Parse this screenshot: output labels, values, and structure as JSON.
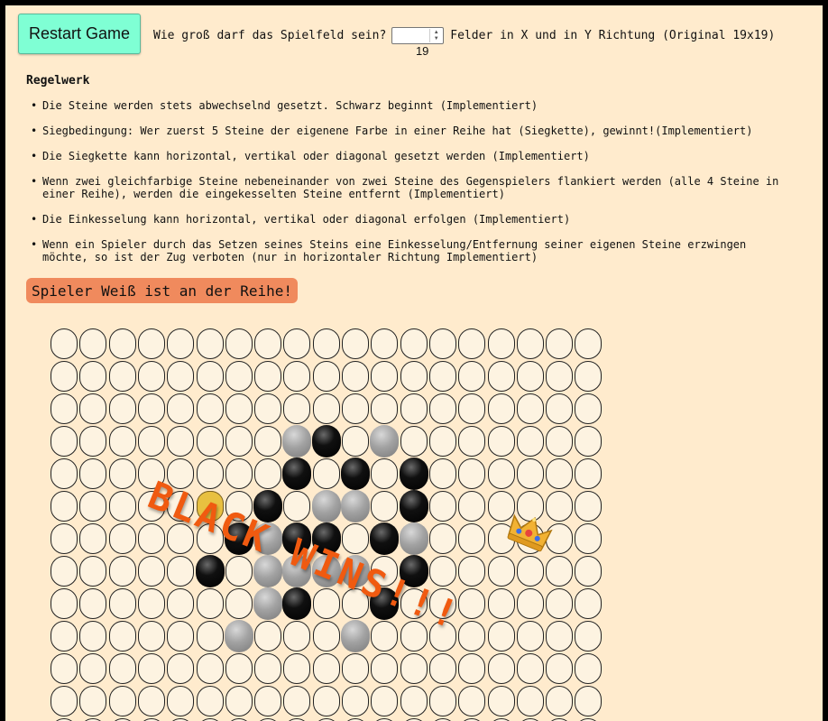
{
  "controls": {
    "restart_label": "Restart Game",
    "size_question": "Wie groß darf das Spielfeld sein?",
    "size_value": "19",
    "size_suffix": "Felder in X und in Y Richtung (Original 19x19)"
  },
  "rules": {
    "title": "Regelwerk",
    "items": [
      "Die Steine werden stets abwechselnd gesetzt. Schwarz beginnt (Implementiert)",
      "Siegbedingung: Wer zuerst 5 Steine der eigenene Farbe in einer Reihe hat (Siegkette), gewinnt!(Implementiert)",
      "Die Siegkette kann horizontal, vertikal oder diagonal gesetzt werden (Implementiert)",
      "Wenn zwei gleichfarbige Steine nebeneinander von zwei Steine des Gegenspielers flankiert werden (alle 4 Steine in einer Reihe), werden die eingekesselten Steine entfernt (Implementiert)",
      "Die Einkesselung kann horizontal, vertikal oder diagonal erfolgen (Implementiert)",
      "Wenn ein Spieler durch das Setzen seines Steins eine Einkesselung/Entfernung seiner eigenen Steine erzwingen möchte, so ist der Zug verboten (nur in horizontaler Richtung Implementiert)"
    ]
  },
  "status": {
    "turn_text": "Spieler Weiß ist an der Reihe!",
    "turn_color": "#f08a5d"
  },
  "board": {
    "columns": 19,
    "visible_rows": 13,
    "stones": [
      {
        "r": 3,
        "c": 8,
        "color": "gray"
      },
      {
        "r": 3,
        "c": 9,
        "color": "black"
      },
      {
        "r": 3,
        "c": 11,
        "color": "gray"
      },
      {
        "r": 4,
        "c": 8,
        "color": "black"
      },
      {
        "r": 4,
        "c": 10,
        "color": "black"
      },
      {
        "r": 4,
        "c": 12,
        "color": "black"
      },
      {
        "r": 5,
        "c": 5,
        "color": "gold"
      },
      {
        "r": 5,
        "c": 7,
        "color": "black"
      },
      {
        "r": 5,
        "c": 9,
        "color": "gray"
      },
      {
        "r": 5,
        "c": 10,
        "color": "gray"
      },
      {
        "r": 5,
        "c": 12,
        "color": "black"
      },
      {
        "r": 6,
        "c": 6,
        "color": "black"
      },
      {
        "r": 6,
        "c": 7,
        "color": "gray"
      },
      {
        "r": 6,
        "c": 8,
        "color": "black"
      },
      {
        "r": 6,
        "c": 9,
        "color": "black"
      },
      {
        "r": 6,
        "c": 11,
        "color": "black"
      },
      {
        "r": 6,
        "c": 12,
        "color": "gray"
      },
      {
        "r": 7,
        "c": 5,
        "color": "black"
      },
      {
        "r": 7,
        "c": 7,
        "color": "gray"
      },
      {
        "r": 7,
        "c": 8,
        "color": "gray"
      },
      {
        "r": 7,
        "c": 9,
        "color": "gray"
      },
      {
        "r": 7,
        "c": 10,
        "color": "gray"
      },
      {
        "r": 7,
        "c": 12,
        "color": "black"
      },
      {
        "r": 8,
        "c": 7,
        "color": "gray"
      },
      {
        "r": 8,
        "c": 8,
        "color": "black"
      },
      {
        "r": 8,
        "c": 11,
        "color": "black"
      },
      {
        "r": 9,
        "c": 6,
        "color": "gray"
      },
      {
        "r": 9,
        "c": 10,
        "color": "gray"
      }
    ]
  },
  "overlay": {
    "win_text": "BLACK WINS!!!",
    "win_color": "#f05a10",
    "crown_icon": "crown-icon"
  }
}
